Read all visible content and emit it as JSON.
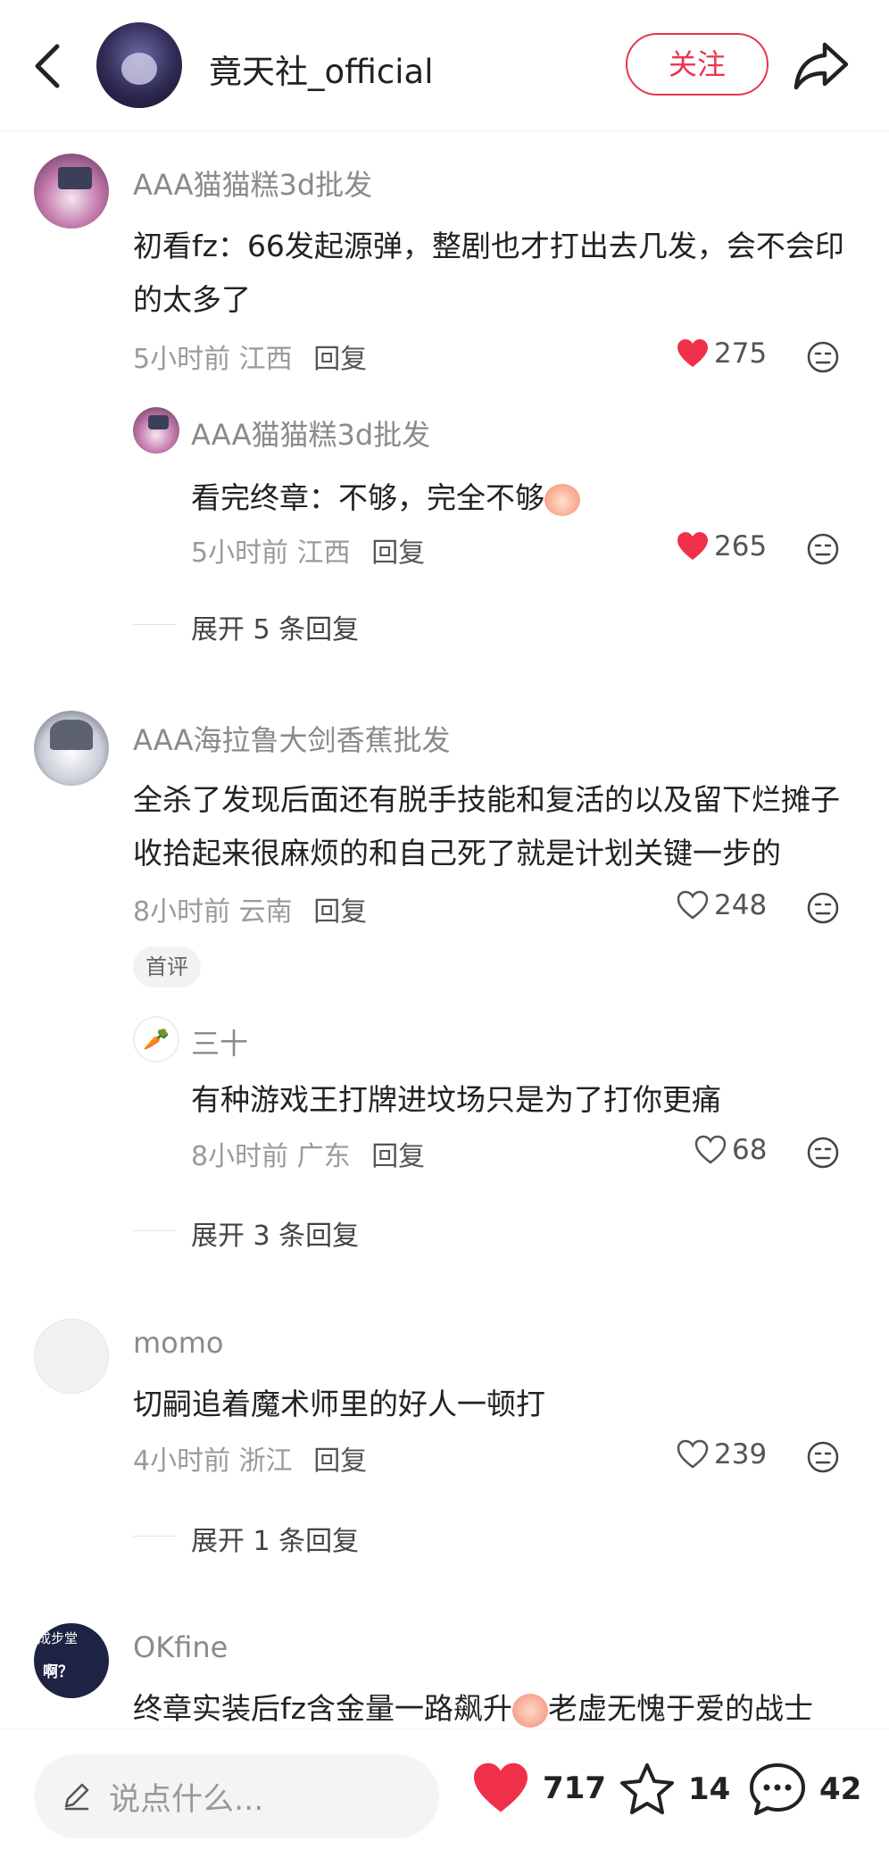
{
  "header": {
    "title": "竟天社_official",
    "follow_label": "关注"
  },
  "comments": [
    {
      "username": "AAA猫猫糕3d批发",
      "content": "初看fz：66发起源弹，整剧也才打出去几发，会不会印的太多了",
      "time": "5小时前",
      "location": "江西",
      "reply_label": "回复",
      "likes": "275",
      "liked": true,
      "replies": [
        {
          "username": "AAA猫猫糕3d批发",
          "content": "看完终章：不够，完全不够",
          "time": "5小时前",
          "location": "江西",
          "reply_label": "回复",
          "likes": "265",
          "liked": true
        }
      ],
      "expand_label": "展开 5 条回复"
    },
    {
      "username": "AAA海拉鲁大剑香蕉批发",
      "content": "全杀了发现后面还有脱手技能和复活的以及留下烂摊子收拾起来很麻烦的和自己死了就是计划关键一步的",
      "time": "8小时前",
      "location": "云南",
      "reply_label": "回复",
      "likes": "248",
      "liked": false,
      "badge": "首评",
      "replies": [
        {
          "username": "三十",
          "content": "有种游戏王打牌进坟场只是为了打你更痛",
          "time": "8小时前",
          "location": "广东",
          "reply_label": "回复",
          "likes": "68",
          "liked": false
        }
      ],
      "expand_label": "展开 3 条回复"
    },
    {
      "username": "momo",
      "content": "切嗣追着魔术师里的好人一顿打",
      "time": "4小时前",
      "location": "浙江",
      "reply_label": "回复",
      "likes": "239",
      "liked": false,
      "expand_label": "展开 1 条回复"
    },
    {
      "username": "OKfine",
      "avatar_text_top": "成步堂",
      "avatar_text_bottom": "啊？",
      "content_part1": "终章实装后fz含金量一路飙升",
      "content_part2": "老虚无愧于爱的战士"
    }
  ],
  "bottom_bar": {
    "input_placeholder": "说点什么...",
    "likes": "717",
    "stars": "14",
    "comments": "42"
  },
  "colors": {
    "accent": "#e8354f",
    "liked_heart": "#f0304a"
  }
}
